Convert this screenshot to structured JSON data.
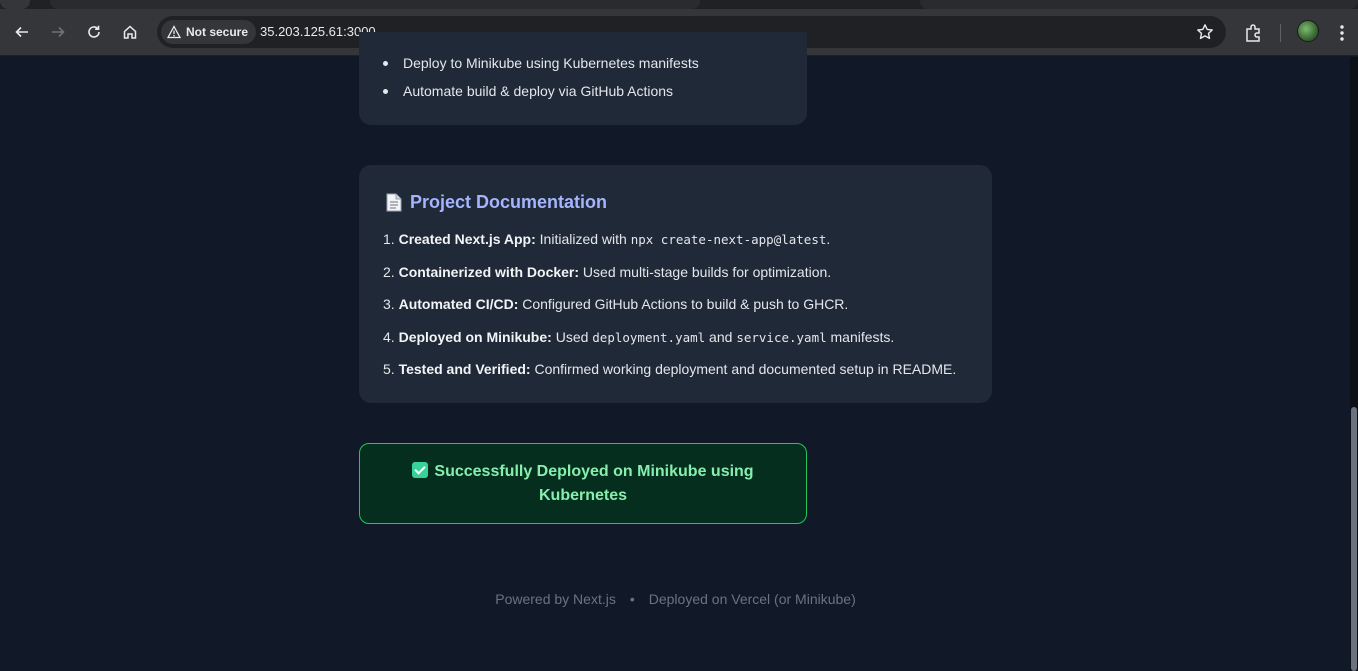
{
  "browser": {
    "security_label": "Not secure",
    "url": "35.203.125.61:3000"
  },
  "goals": {
    "items": [
      "Deploy to Minikube using Kubernetes manifests",
      "Automate build & deploy via GitHub Actions"
    ]
  },
  "docs": {
    "title": "Project Documentation",
    "items": [
      {
        "num": "1.",
        "bold": "Created Next.js App:",
        "pre": " Initialized with ",
        "code": "npx create-next-app@latest",
        "mid": ".",
        "code2": "",
        "post": ""
      },
      {
        "num": "2.",
        "bold": "Containerized with Docker:",
        "pre": " Used multi-stage builds for optimization.",
        "code": "",
        "mid": "",
        "code2": "",
        "post": ""
      },
      {
        "num": "3.",
        "bold": "Automated CI/CD:",
        "pre": " Configured GitHub Actions to build & push to GHCR.",
        "code": "",
        "mid": "",
        "code2": "",
        "post": ""
      },
      {
        "num": "4.",
        "bold": "Deployed on Minikube:",
        "pre": " Used ",
        "code": "deployment.yaml",
        "mid": " and ",
        "code2": "service.yaml",
        "post": " manifests."
      },
      {
        "num": "5.",
        "bold": "Tested and Verified:",
        "pre": " Confirmed working deployment and documented setup in README.",
        "code": "",
        "mid": "",
        "code2": "",
        "post": ""
      }
    ]
  },
  "status": {
    "message": "Successfully Deployed on Minikube using Kubernetes",
    "color": "#22c55e"
  },
  "footer": {
    "powered": "Powered by Next.js",
    "separator": "•",
    "deployed": "Deployed on Vercel (or Minikube)"
  },
  "colors": {
    "background": "#111827",
    "card": "#1f2937",
    "accent": "#a5b4fc"
  }
}
